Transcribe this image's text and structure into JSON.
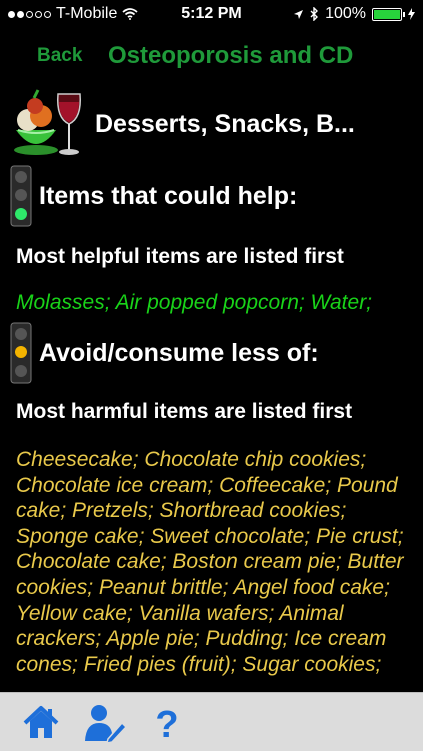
{
  "status_bar": {
    "carrier": "T-Mobile",
    "time": "5:12 PM",
    "battery": "100%",
    "battery_color": "#28d33c"
  },
  "nav": {
    "back_label": "Back",
    "title": "Osteoporosis and CD",
    "accent_color": "#1f9a3a"
  },
  "category": {
    "title": "Desserts, Snacks, B..."
  },
  "help_section": {
    "heading": "Items that could help:",
    "subheading": "Most helpful items are listed first",
    "items": "Molasses; Air popped popcorn; Water;"
  },
  "avoid_section": {
    "heading": "Avoid/consume less of:",
    "subheading": "Most harmful items are listed first",
    "items": "Cheesecake; Chocolate chip cookies; Chocolate ice cream; Coffeecake; Pound cake; Pretzels; Shortbread cookies; Sponge cake; Sweet chocolate; Pie crust; Chocolate cake; Boston cream pie; Butter cookies; Peanut brittle; Angel food cake; Yellow cake; Vanilla wafers; Animal crackers; Apple pie; Pudding; Ice cream cones; Fried pies (fruit); Sugar cookies;"
  },
  "tabbar": {
    "tabs": [
      "home-icon",
      "user-edit-icon",
      "help-icon"
    ],
    "icon_color": "#1e6fd9"
  }
}
